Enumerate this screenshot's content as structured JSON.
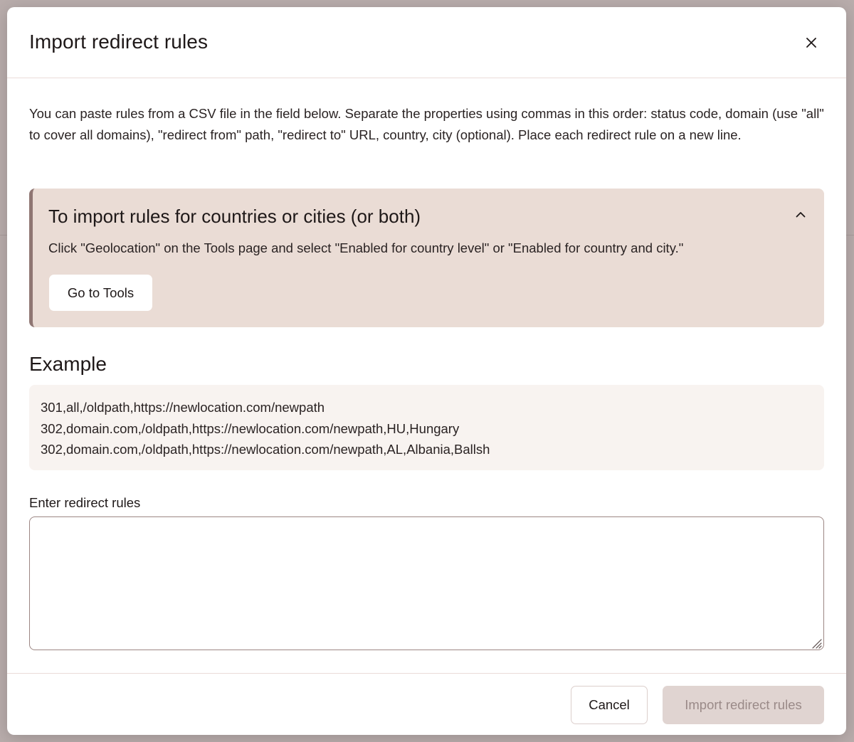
{
  "modal": {
    "title": "Import redirect rules",
    "close_icon": "close-icon"
  },
  "intro": {
    "text": "You can paste rules from a CSV file in the field below. Separate the properties using commas in this order: status code, domain (use \"all\" to cover all domains), \"redirect from\" path, \"redirect to\" URL, country, city (optional). Place each redirect rule on a new line."
  },
  "callout": {
    "title": "To import rules for countries or cities (or both)",
    "text": "Click \"Geolocation\" on the Tools page and select \"Enabled for country level\" or \"Enabled for country and city.\"",
    "button_label": "Go to Tools",
    "toggle_icon": "chevron-up-icon"
  },
  "example": {
    "title": "Example",
    "lines": [
      "301,all,/oldpath,https://newlocation.com/newpath",
      "302,domain.com,/oldpath,https://newlocation.com/newpath,HU,Hungary",
      "302,domain.com,/oldpath,https://newlocation.com/newpath,AL,Albania,Ballsh"
    ]
  },
  "rules_field": {
    "label": "Enter redirect rules",
    "value": "",
    "placeholder": ""
  },
  "footer": {
    "cancel_label": "Cancel",
    "import_label": "Import redirect rules"
  },
  "colors": {
    "callout_bg": "#eadcd5",
    "callout_accent": "#8f7673",
    "example_bg": "#f8f3f0",
    "disabled_btn_bg": "#e0d4d1",
    "disabled_btn_text": "#9a8a88",
    "overlay": "#b9adac"
  }
}
